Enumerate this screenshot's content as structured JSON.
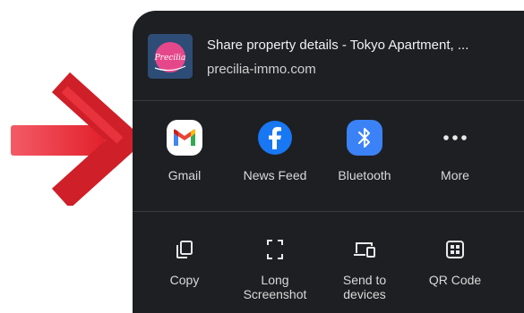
{
  "share": {
    "title": "Share property details - Tokyo Apartment, ...",
    "url": "precilia-immo.com",
    "thumbnail_text": "Precilia"
  },
  "apps": [
    {
      "label": "Gmail",
      "icon": "gmail-icon"
    },
    {
      "label": "News Feed",
      "icon": "facebook-icon"
    },
    {
      "label": "Bluetooth",
      "icon": "bluetooth-icon"
    },
    {
      "label": "More",
      "icon": "more-icon"
    }
  ],
  "actions": [
    {
      "label": "Copy",
      "icon": "copy-icon"
    },
    {
      "label": "Long\nScreenshot",
      "icon": "long-screenshot-icon"
    },
    {
      "label": "Send to\ndevices",
      "icon": "send-to-devices-icon"
    },
    {
      "label": "QR Code",
      "icon": "qr-code-icon"
    }
  ],
  "colors": {
    "sheet": "#1e1f22",
    "arrow": "#e2202a",
    "facebook": "#1877f2",
    "bluetooth": "#3b82f6"
  }
}
